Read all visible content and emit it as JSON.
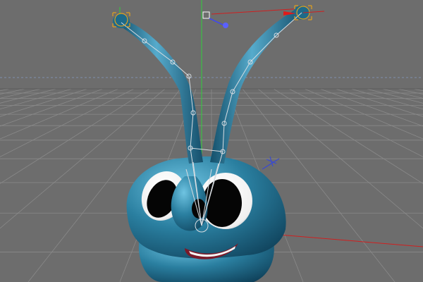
{
  "viewport": {
    "colors": {
      "background": "#6d6d6d",
      "grid": "#8a8a8a",
      "grid_horizon": "#5e5e5e",
      "axis_y": "#2fcf3a",
      "axis_x": "#d01f1f",
      "horizon_dash": "#7a8aa6",
      "character_body": "#1f6f8f",
      "character_dark": "#0f4058",
      "character_light": "#5fb3d3",
      "rig_bones": "#d8dde2",
      "rig_controllers": "#e0a020",
      "eye_white": "#ffffff",
      "pupil": "#050505",
      "mouth": "#7a1a2a",
      "teeth": "#f5f5f5",
      "selection_handle": "#4a52ff"
    },
    "icons": [
      "axis-gizmo-icon",
      "light-gizmo-icon",
      "null-object-icon"
    ]
  }
}
